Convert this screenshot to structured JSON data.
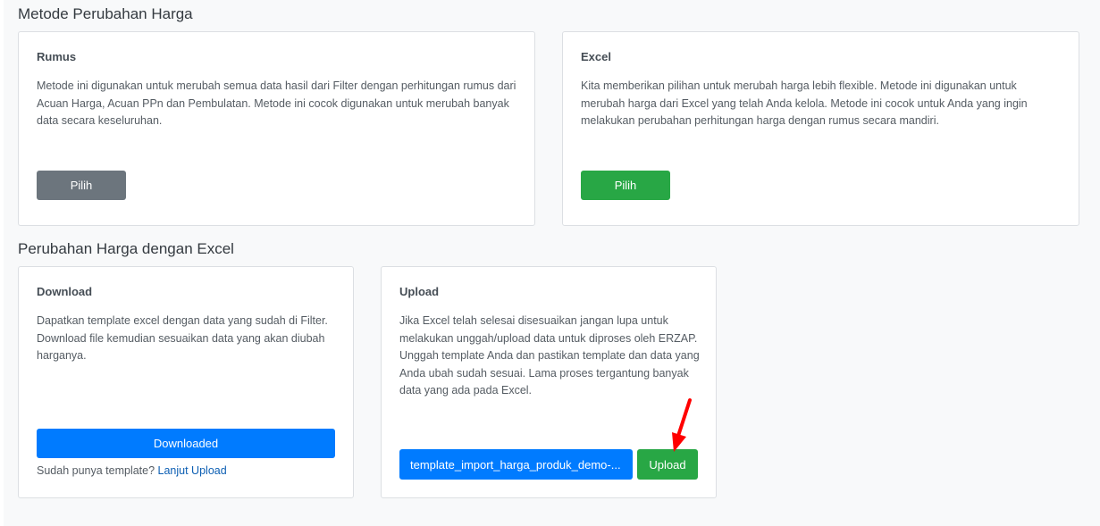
{
  "methods_section": {
    "title": "Metode Perubahan Harga",
    "cards": [
      {
        "title": "Rumus",
        "text": "Metode ini digunakan untuk merubah semua data hasil dari Filter dengan perhitungan rumus dari Acuan Harga, Acuan PPn dan Pembulatan. Metode ini cocok digunakan untuk merubah banyak data secara keseluruhan.",
        "button": "Pilih"
      },
      {
        "title": "Excel",
        "text": "Kita memberikan pilihan untuk merubah harga lebih flexible. Metode ini digunakan untuk merubah harga dari Excel yang telah Anda kelola. Metode ini cocok untuk Anda yang ingin melakukan perubahan perhitungan harga dengan rumus secara mandiri.",
        "button": "Pilih"
      }
    ]
  },
  "excel_section": {
    "title": "Perubahan Harga dengan Excel",
    "download": {
      "title": "Download",
      "text": "Dapatkan template excel dengan data yang sudah di Filter. Download file kemudian sesuaikan data yang akan diubah harganya.",
      "button": "Downloaded",
      "hint": "Sudah punya template?",
      "link": "Lanjut Upload"
    },
    "upload": {
      "title": "Upload",
      "text": "Jika Excel telah selesai disesuaikan jangan lupa untuk melakukan unggah/upload data untuk diproses oleh ERZAP. Unggah template Anda dan pastikan template dan data yang Anda ubah sudah sesuai. Lama proses tergantung banyak data yang ada pada Excel.",
      "file_button": "template_import_harga_produk_demo-...",
      "upload_button": "Upload"
    }
  },
  "colors": {
    "gray_button": "#6c757d",
    "green_button": "#28a745",
    "blue_button": "#007bff",
    "annotation_arrow": "#ff0000"
  }
}
